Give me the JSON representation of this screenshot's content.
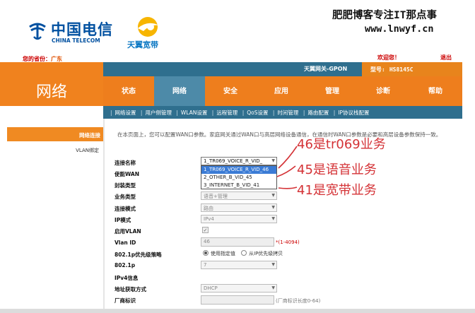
{
  "brand": {
    "ct_cn": "中国电信",
    "ct_en": "CHINA TELECOM",
    "tianyi": "天翼宽带",
    "colors": {
      "ct_blue": "#0050a0",
      "orange": "#ee7e1d",
      "teal": "#2f6f8e",
      "active_tab": "#4d8aa8"
    }
  },
  "watermark": {
    "line1": "肥肥博客专注IT那点事",
    "line2": "www.lnwyf.cn"
  },
  "header": {
    "location_label": "您的省份：",
    "location_value": "广东",
    "welcome": "欢迎您！",
    "logout": "退出",
    "router_name": "天翼网关-GPON",
    "model_label": "型号:",
    "model_value": "HS8145C"
  },
  "section_title": "网络",
  "nav": {
    "items": [
      {
        "label": "状态"
      },
      {
        "label": "网络"
      },
      {
        "label": "安全"
      },
      {
        "label": "应用"
      },
      {
        "label": "管理"
      },
      {
        "label": "诊断"
      },
      {
        "label": "帮助"
      }
    ],
    "active": "网络"
  },
  "subnav": [
    "网络设置",
    "用户侧管理",
    "WLAN设置",
    "远程管理",
    "QoS设置",
    "时间管理",
    "路由配置",
    "IP协议栈配置"
  ],
  "sidebar": {
    "items": [
      {
        "label": "网络连接",
        "active": true
      },
      {
        "label": "VLAN绑定",
        "active": false
      }
    ]
  },
  "content": {
    "description": "在本页面上，您可以配置WAN口参数。家庭网关通过WAN口与高层网络设备通信，在通信时WAN口参数是必要和高层设备参数保持一致。",
    "fields": {
      "connection_name": {
        "label": "连接名称",
        "value": "1_TR069_VOICE_R_VID_"
      },
      "enable_wan": {
        "label": "使能WAN"
      },
      "encap_type": {
        "label": "封装类型"
      },
      "service_type": {
        "label": "业务类型",
        "value": "语音+管理"
      },
      "conn_mode": {
        "label": "连接模式",
        "value": "路由"
      },
      "ip_mode": {
        "label": "IP模式",
        "value": "IPv4"
      },
      "enable_vlan": {
        "label": "启用VLAN"
      },
      "vlan_id": {
        "label": "Vlan ID",
        "value": "46",
        "hint": "*(1-4094)"
      },
      "priority_policy": {
        "label": "802.1p优先级策略",
        "opt1": "使用指定值",
        "opt2": "从IP优先级拷贝"
      },
      "priority": {
        "label": "802.1p",
        "value": "7"
      },
      "ipv4_info": {
        "label": "IPv4信息"
      },
      "addr_mode": {
        "label": "地址获取方式",
        "value": "DHCP"
      },
      "vendor_id": {
        "label": "厂商标识",
        "hint": "(厂商标识长度0-64)"
      }
    },
    "dropdown_options": [
      {
        "label": "1_TR069_VOICE_R_VID_46",
        "selected": true
      },
      {
        "label": "2_OTHER_B_VID_45",
        "selected": false
      },
      {
        "label": "3_INTERNET_B_VID_41",
        "selected": false
      }
    ]
  },
  "annotations": [
    {
      "text": "46是tr069业务"
    },
    {
      "text": "45是语音业务"
    },
    {
      "text": "41是宽带业务"
    }
  ]
}
